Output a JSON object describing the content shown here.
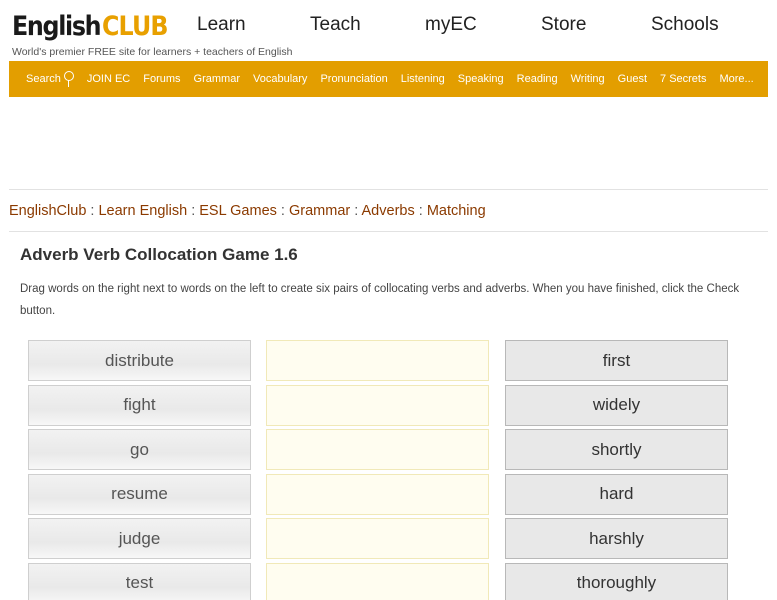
{
  "header": {
    "logo": {
      "english": "English",
      "club": "CLUB"
    },
    "tagline": "World's premier FREE site for learners + teachers of English",
    "nav": [
      "Learn",
      "Teach",
      "myEC",
      "Store",
      "Schools"
    ]
  },
  "menubar": {
    "search_label": "Search",
    "items": [
      "JOIN EC",
      "Forums",
      "Grammar",
      "Vocabulary",
      "Pronunciation",
      "Listening",
      "Speaking",
      "Reading",
      "Writing",
      "Guest",
      "7 Secrets",
      "More..."
    ]
  },
  "breadcrumb": [
    "EnglishClub",
    "Learn English",
    "ESL Games",
    "Grammar",
    "Adverbs",
    "Matching"
  ],
  "breadcrumb_separator": ":",
  "page": {
    "title": "Adverb Verb Collocation Game 1.6",
    "instructions": "Drag words on the right next to words on the left to create six pairs of collocating verbs and adverbs. When you have finished, click the Check button."
  },
  "game": {
    "verbs": [
      "distribute",
      "fight",
      "go",
      "resume",
      "judge",
      "test"
    ],
    "adverbs": [
      "first",
      "widely",
      "shortly",
      "hard",
      "harshly",
      "thoroughly"
    ]
  },
  "colors": {
    "accent": "#e39e00",
    "link": "#8b3a00"
  }
}
